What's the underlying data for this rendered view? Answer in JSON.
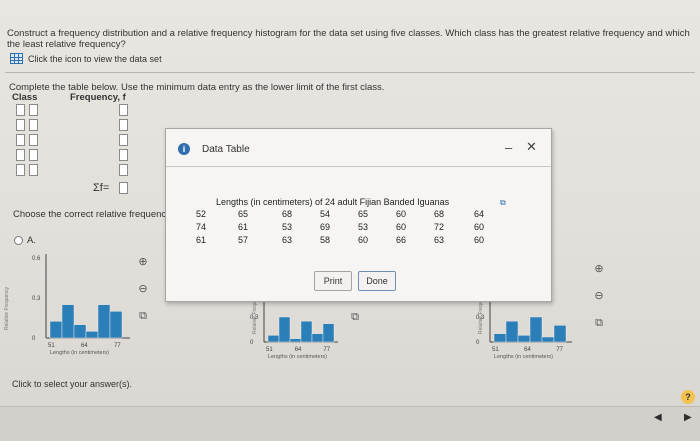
{
  "question": {
    "text": "Construct a frequency distribution and a relative frequency histogram for the data set using five classes. Which class has the greatest relative frequency and which the least relative frequency?",
    "view_data_label": "Click the icon to view the data set"
  },
  "instructions": "Complete the table below. Use the minimum data entry as the lower limit of the first class.",
  "table": {
    "class_header": "Class",
    "freq_header": "Frequency, f",
    "sum_label": "Σf="
  },
  "choose_label": "Choose the correct relative frequency",
  "option_a": "A.",
  "chart_axis": {
    "ylabel": "Relative Frequency",
    "y_ticks": [
      "0.6",
      "0.3",
      "0"
    ],
    "x_ticks": [
      "51",
      "64",
      "77"
    ],
    "xlabel": "Lengths (in centimeters)"
  },
  "chart_data": [
    {
      "type": "bar",
      "title": "",
      "xlabel": "Lengths (in centimeters)",
      "ylabel": "Relative Frequency",
      "ylim": [
        0,
        0.6
      ],
      "x_ticks": [
        51,
        64,
        77
      ],
      "series": [
        {
          "values": [
            0.125,
            0.25,
            0.1,
            0.05,
            0.25,
            0.2
          ]
        }
      ]
    },
    {
      "type": "bar",
      "title": "",
      "xlabel": "Lengths (in centimeters)",
      "ylabel": "Relative Frequency",
      "ylim": [
        0,
        0.6
      ],
      "x_ticks": [
        51,
        64,
        77
      ],
      "series": [
        {
          "values": [
            0.08,
            0.3,
            0.04,
            0.25,
            0.1,
            0.22
          ]
        }
      ]
    },
    {
      "type": "bar",
      "title": "",
      "xlabel": "Lengths (in centimeters)",
      "ylabel": "Relative Frequency",
      "ylim": [
        0,
        0.6
      ],
      "x_ticks": [
        51,
        64,
        77
      ],
      "series": [
        {
          "values": [
            0.1,
            0.25,
            0.08,
            0.3,
            0.06,
            0.2
          ]
        }
      ]
    }
  ],
  "click_select": "Click to select your answer(s).",
  "help": "?",
  "modal": {
    "title": "Data Table",
    "minimize": "–",
    "close": "✕",
    "table_title": "Lengths (in centimeters) of 24 adult Fijian Banded Iguanas",
    "rows": [
      [
        "52",
        "65",
        "68",
        "54",
        "65",
        "60",
        "68",
        "64"
      ],
      [
        "74",
        "61",
        "53",
        "69",
        "53",
        "60",
        "72",
        "60"
      ],
      [
        "61",
        "57",
        "63",
        "58",
        "60",
        "66",
        "63",
        "60"
      ]
    ],
    "print_label": "Print",
    "done_label": "Done"
  },
  "colors": {
    "bar": "#2a7fb8",
    "accent": "#2f6fad"
  },
  "icons": [
    "grid-icon",
    "info-icon",
    "magnify-plus-icon",
    "magnify-minus-icon",
    "external-link-icon",
    "copy-icon",
    "help-icon",
    "prev-arrow-icon",
    "next-arrow-icon"
  ],
  "nav": {
    "prev": "◀",
    "next": "▶"
  }
}
